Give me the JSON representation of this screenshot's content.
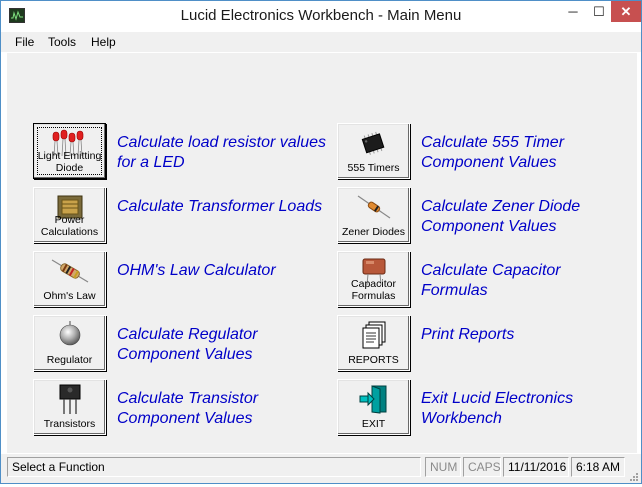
{
  "window": {
    "title": "Lucid Electronics Workbench - Main Menu",
    "controls": {
      "minimize": "─",
      "maximize": "☐",
      "close": "✕"
    }
  },
  "menu": {
    "file": "File",
    "tools": "Tools",
    "help": "Help"
  },
  "functions": {
    "led": {
      "label": "Light Emitting Diode",
      "desc": "Calculate load resistor values for a LED",
      "icon": "led-icon"
    },
    "power": {
      "label": "Power Calculations",
      "desc": "Calculate Transformer Loads",
      "icon": "transformer-icon"
    },
    "ohms": {
      "label": "Ohm's Law",
      "desc": "OHM's Law Calculator",
      "icon": "resistor-icon"
    },
    "regulator": {
      "label": "Regulator",
      "desc": "Calculate Regulator Component Values",
      "icon": "regulator-icon"
    },
    "transistors": {
      "label": "Transistors",
      "desc": "Calculate Transistor Component Values",
      "icon": "transistor-icon"
    },
    "timer555": {
      "label": "555 Timers",
      "desc": "Calculate 555 Timer Component Values",
      "icon": "ic-chip-icon"
    },
    "zener": {
      "label": "Zener Diodes",
      "desc": "Calculate Zener Diode Component Values",
      "icon": "diode-icon"
    },
    "capacitor": {
      "label": "Capacitor Formulas",
      "desc": "Calculate Capacitor Formulas",
      "icon": "capacitor-icon"
    },
    "reports": {
      "label": "REPORTS",
      "desc": "Print Reports",
      "icon": "report-icon"
    },
    "exit": {
      "label": "EXIT",
      "desc": "Exit Lucid Electronics Workbench",
      "icon": "exit-door-icon"
    }
  },
  "status": {
    "message": "Select a Function",
    "num": "NUM",
    "caps": "CAPS",
    "date": "11/11/2016",
    "time": "6:18 AM"
  },
  "colors": {
    "link_text": "#0000c8",
    "face": "#f0f0f0",
    "close": "#c75050"
  }
}
